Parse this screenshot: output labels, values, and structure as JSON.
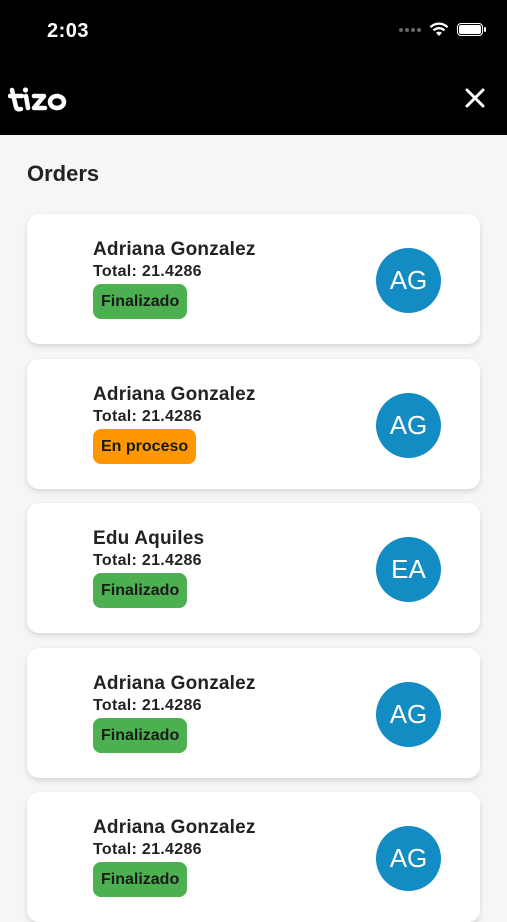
{
  "status_bar": {
    "time": "2:03"
  },
  "header": {
    "logo_text": "tizo",
    "close_icon": "close-icon"
  },
  "page": {
    "title": "Orders"
  },
  "colors": {
    "finalizado": "#4caf50",
    "en_proceso": "#ff9800",
    "avatar": "#138cc3"
  },
  "orders": [
    {
      "name": "Adriana Gonzalez",
      "total": "Total: 21.4286",
      "status": "Finalizado",
      "status_key": "finalizado",
      "initials": "AG"
    },
    {
      "name": "Adriana Gonzalez",
      "total": "Total: 21.4286",
      "status": "En proceso",
      "status_key": "en_proceso",
      "initials": "AG"
    },
    {
      "name": "Edu Aquiles",
      "total": "Total: 21.4286",
      "status": "Finalizado",
      "status_key": "finalizado",
      "initials": "EA"
    },
    {
      "name": "Adriana Gonzalez",
      "total": "Total: 21.4286",
      "status": "Finalizado",
      "status_key": "finalizado",
      "initials": "AG"
    },
    {
      "name": "Adriana Gonzalez",
      "total": "Total: 21.4286",
      "status": "Finalizado",
      "status_key": "finalizado",
      "initials": "AG"
    }
  ]
}
